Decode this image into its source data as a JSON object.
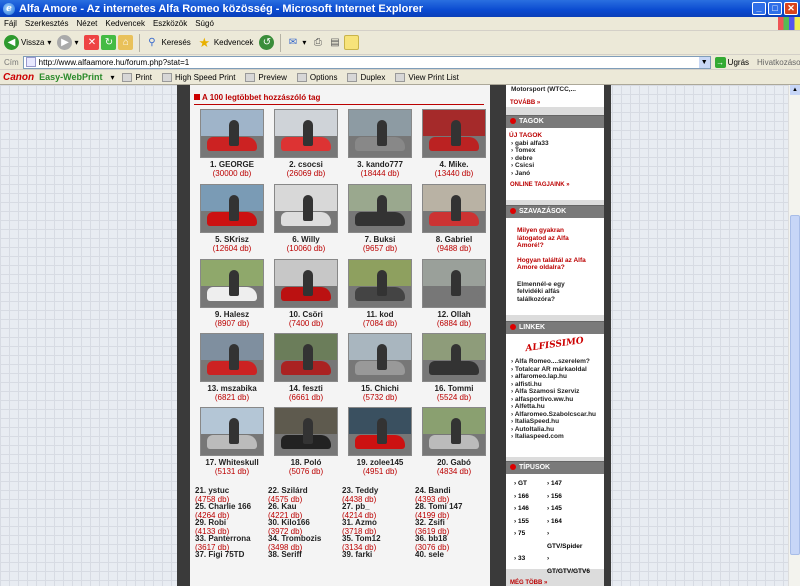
{
  "window": {
    "title": "Alfa Amore - Az internetes Alfa Romeo közösség - Microsoft Internet Explorer"
  },
  "menu": [
    "Fájl",
    "Szerkesztés",
    "Nézet",
    "Kedvencek",
    "Eszközök",
    "Súgó"
  ],
  "toolbar": {
    "back": "Vissza",
    "search": "Keresés",
    "favorites": "Kedvencek"
  },
  "address": {
    "label": "Cím",
    "url": "http://www.alfaamore.hu/forum.php?stat=1",
    "go": "Ugrás",
    "links": "Hivatkozások"
  },
  "canon": {
    "brand": "Canon",
    "product": "Easy-WebPrint",
    "items": [
      "Print",
      "High Speed Print",
      "Preview",
      "Options",
      "Duplex",
      "View Print List"
    ]
  },
  "main": {
    "heading": "A 100 legtöbbet hozzászóló tag",
    "top": [
      {
        "name": "1. GEORGE",
        "count": "(30000 db)"
      },
      {
        "name": "2. csocsi",
        "count": "(26069 db)"
      },
      {
        "name": "3. kando777",
        "count": "(18444 db)"
      },
      {
        "name": "4. Mike.",
        "count": "(13440 db)"
      },
      {
        "name": "5. SKrisz",
        "count": "(12604 db)"
      },
      {
        "name": "6. Willy",
        "count": "(10060 db)"
      },
      {
        "name": "7. Buksi",
        "count": "(9657 db)"
      },
      {
        "name": "8. Gabriel",
        "count": "(9488 db)"
      },
      {
        "name": "9. Halesz",
        "count": "(8907 db)"
      },
      {
        "name": "10. Csöri",
        "count": "(7400 db)"
      },
      {
        "name": "11. kod",
        "count": "(7084 db)"
      },
      {
        "name": "12. Ollah",
        "count": "(6884 db)"
      },
      {
        "name": "13. mszabika",
        "count": "(6821 db)"
      },
      {
        "name": "14. feszti",
        "count": "(6661 db)"
      },
      {
        "name": "15. Chichi",
        "count": "(5732 db)"
      },
      {
        "name": "16. Tommi",
        "count": "(5524 db)"
      },
      {
        "name": "17. Whiteskull",
        "count": "(5131 db)"
      },
      {
        "name": "18. Poló",
        "count": "(5076 db)"
      },
      {
        "name": "19. zolee145",
        "count": "(4951 db)"
      },
      {
        "name": "20. Gabó",
        "count": "(4834 db)"
      }
    ],
    "rest": [
      {
        "name": "21. ystuc",
        "count": "(4758 db)"
      },
      {
        "name": "22. Szilárd",
        "count": "(4575 db)"
      },
      {
        "name": "23. Teddy",
        "count": "(4438 db)"
      },
      {
        "name": "24. Bandi",
        "count": "(4393 db)"
      },
      {
        "name": "25. Charlie 166",
        "count": "(4264 db)"
      },
      {
        "name": "26. Kau",
        "count": "(4221 db)"
      },
      {
        "name": "27. pb_",
        "count": "(4214 db)"
      },
      {
        "name": "28. Tomi 147",
        "count": "(4199 db)"
      },
      {
        "name": "29. Robi",
        "count": "(4133 db)"
      },
      {
        "name": "30. Kilo166",
        "count": "(3972 db)"
      },
      {
        "name": "31. Azmo",
        "count": "(3718 db)"
      },
      {
        "name": "32. Zsifi",
        "count": "(3619 db)"
      },
      {
        "name": "33. Panterrona",
        "count": "(3617 db)"
      },
      {
        "name": "34. Trombozis",
        "count": "(3498 db)"
      },
      {
        "name": "35. Tom12",
        "count": "(3134 db)"
      },
      {
        "name": "36. bb18",
        "count": "(3076 db)"
      },
      {
        "name": "37. Figi 75TD",
        "count": ""
      },
      {
        "name": "38. Seriff",
        "count": ""
      },
      {
        "name": "39. farki",
        "count": ""
      },
      {
        "name": "40. sele",
        "count": ""
      }
    ]
  },
  "sidebar": {
    "top": {
      "partial": "Motorsport (WTCC,...",
      "more": "TOVÁBB »"
    },
    "members": {
      "title": "TAGOK",
      "subtitle": "ÚJ TAGOK",
      "items": [
        "› gabi alfa33",
        "› Tomex",
        "› debre",
        "› Csicsi",
        "› Janó"
      ],
      "more": "ONLINE TAGJAINK »"
    },
    "polls": {
      "title": "SZAVAZÁSOK",
      "items": [
        [
          "Milyen gyakran",
          "látogatod az Alfa",
          "Amoré!?"
        ],
        [
          "Hogyan találtál az Alfa",
          "Amore oldalra?"
        ],
        [
          "Elmennél-e egy",
          "felvidéki alfás",
          "találkozóra?"
        ]
      ]
    },
    "links": {
      "title": "LINKEK",
      "logo": "ALFISSIMO",
      "items": [
        "› Alfa Romeo....szerelem?",
        "› Totalcar AR márkaoldal",
        "› alfaromeo.lap.hu",
        "› alfisti.hu",
        "› Alfa Szamosi Szerviz",
        "› alfasportivo.ww.hu",
        "› Alfetta.hu",
        "› Alfaromeo.Szabolcscar.hu",
        "› ItaliaSpeed.hu",
        "› AutoItalia.hu",
        "› Italiaspeed.com"
      ]
    },
    "types": {
      "title": "TÍPUSOK",
      "rows": [
        [
          "› GT",
          "› 147"
        ],
        [
          "› 166",
          "› 156"
        ],
        [
          "› 146",
          "› 145"
        ],
        [
          "› 155",
          "› 164"
        ],
        [
          "› 75",
          "› GTV/Spider"
        ],
        [
          "› 33",
          "› GT/GTV/GTV6"
        ]
      ],
      "more": "MÉG TÖBB »"
    }
  }
}
